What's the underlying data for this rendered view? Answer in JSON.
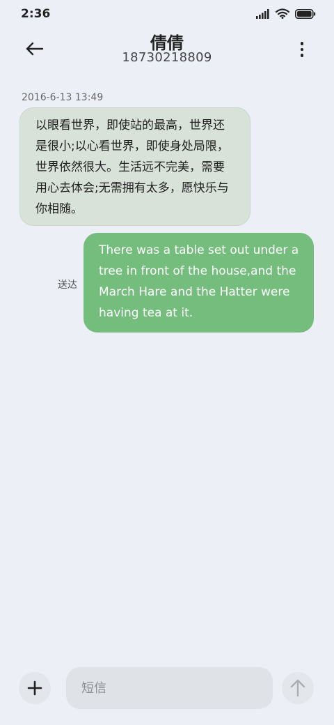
{
  "status_bar": {
    "time": "2:36",
    "icons": [
      "signal-icon",
      "wifi-icon",
      "battery-icon"
    ]
  },
  "header": {
    "back_icon": "arrow-left-icon",
    "contact_name": "倩倩",
    "contact_number": "18730218809",
    "more_icon": "more-vertical-icon"
  },
  "conversation": {
    "timestamp": "2016-6-13 13:49",
    "messages": [
      {
        "direction": "incoming",
        "text": "以眼看世界，即使站的最高，世界还是很小;以心看世界，即使身处局限，世界依然很大。生活远不完美，需要用心去体会;无需拥有太多，愿快乐与你相随。"
      },
      {
        "direction": "outgoing",
        "text": "There was a table set out under a tree in front of the house,and the March Hare and the Hatter were having tea at it.",
        "status": "送达"
      }
    ]
  },
  "compose": {
    "add_icon": "plus-icon",
    "placeholder": "短信",
    "value": "",
    "send_icon": "arrow-up-icon"
  },
  "colors": {
    "background": "#ecf0f6",
    "incoming_bubble": "#d8e2d9",
    "outgoing_bubble": "#74bd7c"
  }
}
